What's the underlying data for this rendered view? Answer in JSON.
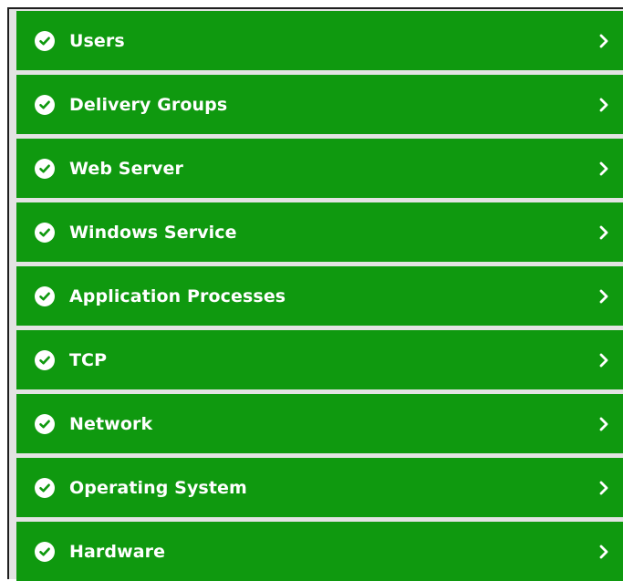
{
  "colors": {
    "row_bg": "#0f990f",
    "text": "#ffffff",
    "icon_bg": "#ffffff"
  },
  "icons": {
    "status": "check-circle-icon",
    "expand": "chevron-right-icon"
  },
  "items": [
    {
      "label": "Users"
    },
    {
      "label": "Delivery Groups"
    },
    {
      "label": "Web Server"
    },
    {
      "label": "Windows Service"
    },
    {
      "label": "Application Processes"
    },
    {
      "label": "TCP"
    },
    {
      "label": "Network"
    },
    {
      "label": "Operating System"
    },
    {
      "label": "Hardware"
    }
  ]
}
